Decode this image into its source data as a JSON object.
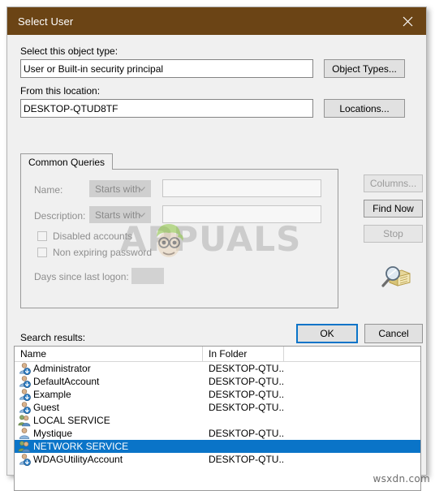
{
  "window": {
    "title": "Select User",
    "close_icon": "close-icon",
    "titlebar_color": "#6b4415",
    "accent_color": "#0a74c8"
  },
  "object_type": {
    "label": "Select this object type:",
    "value": "User or Built-in security principal",
    "button_label": "Object Types..."
  },
  "location": {
    "label": "From this location:",
    "value": "DESKTOP-QTUD8TF",
    "button_label": "Locations..."
  },
  "tabs": [
    {
      "label": "Common Queries",
      "active": true
    }
  ],
  "query_form": {
    "name": {
      "label": "Name:",
      "operator": "Starts with",
      "value": "",
      "disabled": true
    },
    "description": {
      "label": "Description:",
      "operator": "Starts with",
      "value": "",
      "disabled": true
    },
    "checkboxes": [
      {
        "label": "Disabled accounts",
        "checked": false,
        "disabled": true
      },
      {
        "label": "Non expiring password",
        "checked": false,
        "disabled": true
      }
    ],
    "days_since_logon": {
      "label": "Days since last logon:",
      "value": "",
      "disabled": true
    }
  },
  "side_buttons": [
    {
      "label": "Columns...",
      "name": "columns-button",
      "disabled": true
    },
    {
      "label": "Find Now",
      "name": "find-now-button",
      "disabled": false
    },
    {
      "label": "Stop",
      "name": "stop-button",
      "disabled": true
    }
  ],
  "search_icon": "search-folder-icon",
  "dialog_buttons": {
    "ok": "OK",
    "cancel": "Cancel"
  },
  "results": {
    "label": "Search results:",
    "columns": [
      "Name",
      "In Folder",
      ""
    ],
    "rows": [
      {
        "name": "Administrator",
        "folder": "DESKTOP-QTU...",
        "icon": "user-account-icon",
        "selected": false
      },
      {
        "name": "DefaultAccount",
        "folder": "DESKTOP-QTU...",
        "icon": "user-account-icon",
        "selected": false
      },
      {
        "name": "Example",
        "folder": "DESKTOP-QTU...",
        "icon": "user-account-icon",
        "selected": false
      },
      {
        "name": "Guest",
        "folder": "DESKTOP-QTU...",
        "icon": "user-account-icon",
        "selected": false
      },
      {
        "name": "LOCAL SERVICE",
        "folder": "",
        "icon": "service-group-icon",
        "selected": false
      },
      {
        "name": "Mystique",
        "folder": "DESKTOP-QTU...",
        "icon": "user-plain-icon",
        "selected": false
      },
      {
        "name": "NETWORK SERVICE",
        "folder": "",
        "icon": "service-group-icon",
        "selected": true
      },
      {
        "name": "WDAGUtilityAccount",
        "folder": "DESKTOP-QTU...",
        "icon": "user-account-icon",
        "selected": false
      }
    ]
  },
  "watermarks": {
    "appuals": "APPUALS",
    "site": "wsxdn.com"
  }
}
